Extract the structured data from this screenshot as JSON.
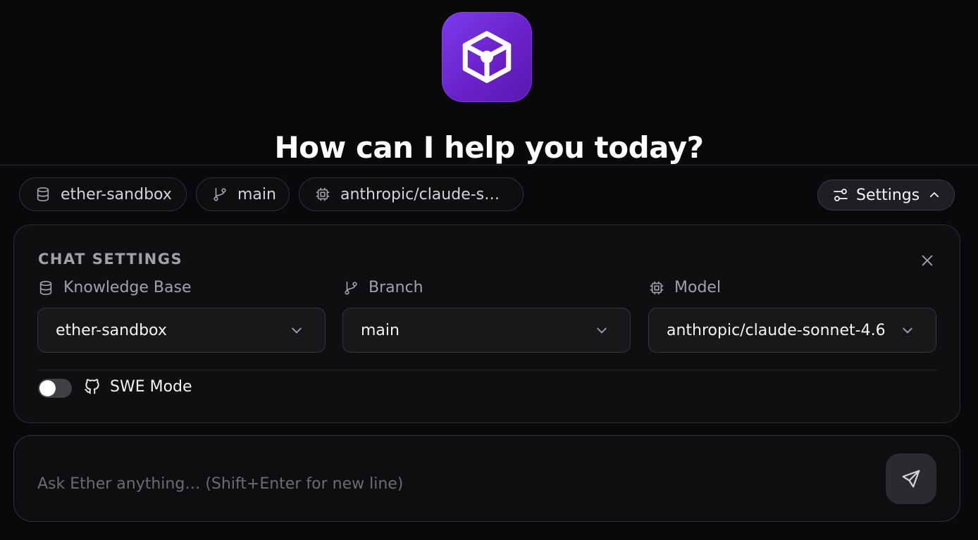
{
  "app": {
    "logo_icon": "cube-icon",
    "heading": "How can I help you today?"
  },
  "chips": {
    "knowledge_base": {
      "label": "ether-sandbox",
      "icon": "database-icon"
    },
    "branch": {
      "label": "main",
      "icon": "git-branch-icon"
    },
    "model": {
      "label": "anthropic/claude-so…",
      "icon": "cpu-icon"
    }
  },
  "settings_button": {
    "label": "Settings",
    "icon": "sliders-icon",
    "state_icon": "chevron-up-icon"
  },
  "chat_settings": {
    "title": "CHAT SETTINGS",
    "close_icon": "close-icon",
    "knowledge_base": {
      "label": "Knowledge Base",
      "value": "ether-sandbox"
    },
    "branch": {
      "label": "Branch",
      "value": "main"
    },
    "model": {
      "label": "Model",
      "value": "anthropic/claude-sonnet-4.6"
    },
    "swe_mode": {
      "label": "SWE Mode",
      "enabled": false,
      "icon": "github-icon"
    }
  },
  "composer": {
    "placeholder": "Ask Ether anything… (Shift+Enter for new line)",
    "value": "",
    "send_icon": "send-icon"
  },
  "colors": {
    "background": "#09090b",
    "accent": "#7c3aed",
    "panel": "#0f0f12",
    "field": "#18181b"
  }
}
